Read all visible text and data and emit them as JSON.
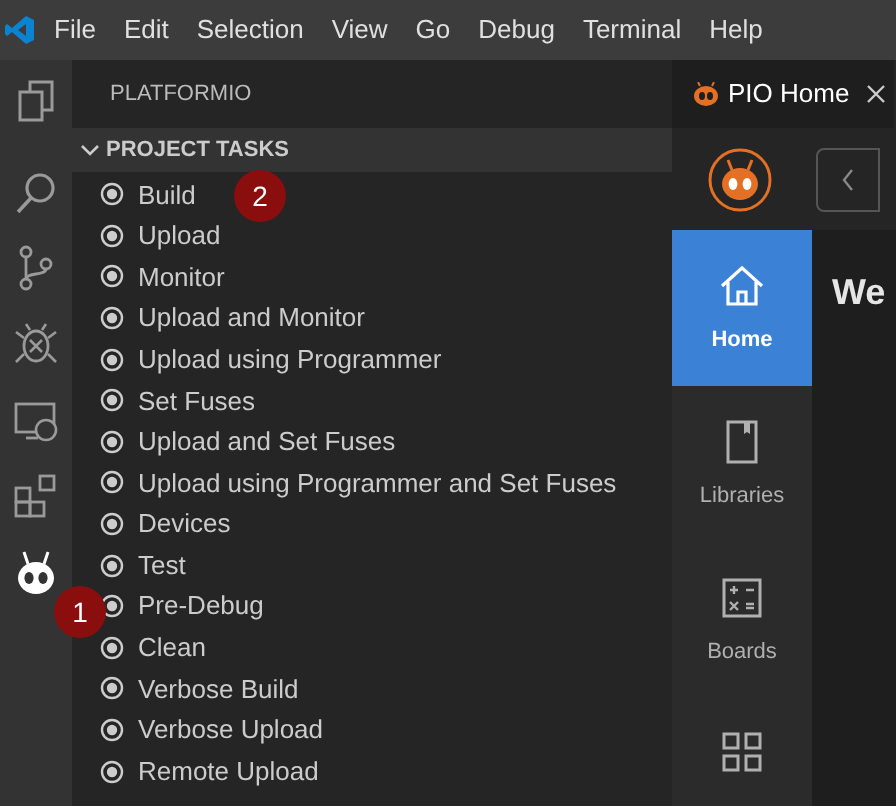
{
  "menu_bar": {
    "items": [
      "File",
      "Edit",
      "Selection",
      "View",
      "Go",
      "Debug",
      "Terminal",
      "Help"
    ]
  },
  "activity_bar": [
    {
      "kind": "files",
      "selected": false
    },
    {
      "kind": "search",
      "selected": false
    },
    {
      "kind": "branch",
      "selected": false
    },
    {
      "kind": "bug",
      "selected": false
    },
    {
      "kind": "remote",
      "selected": false
    },
    {
      "kind": "extensions",
      "selected": false
    },
    {
      "kind": "alien",
      "selected": true,
      "marker": "1"
    }
  ],
  "sidebar": {
    "title": "PLATFORMIO",
    "section": {
      "title": "PROJECT TASKS",
      "expanded": true
    },
    "tasks": [
      {
        "label": "Build",
        "marker": "2"
      },
      {
        "label": "Upload"
      },
      {
        "label": "Monitor"
      },
      {
        "label": "Upload and Monitor"
      },
      {
        "label": "Upload using Programmer"
      },
      {
        "label": "Set Fuses"
      },
      {
        "label": "Upload and Set Fuses"
      },
      {
        "label": "Upload using Programmer and Set Fuses"
      },
      {
        "label": "Devices"
      },
      {
        "label": "Test"
      },
      {
        "label": "Pre-Debug"
      },
      {
        "label": "Clean"
      },
      {
        "label": "Verbose Build"
      },
      {
        "label": "Verbose Upload"
      },
      {
        "label": "Remote Upload"
      }
    ]
  },
  "editor": {
    "tab": {
      "title": "PIO Home"
    },
    "nav": [
      {
        "kind": "home",
        "label": "Home",
        "selected": true
      },
      {
        "kind": "book",
        "label": "Libraries",
        "selected": false
      },
      {
        "kind": "calc",
        "label": "Boards",
        "selected": false
      },
      {
        "kind": "grid",
        "selected": false
      }
    ],
    "heading": "We"
  }
}
